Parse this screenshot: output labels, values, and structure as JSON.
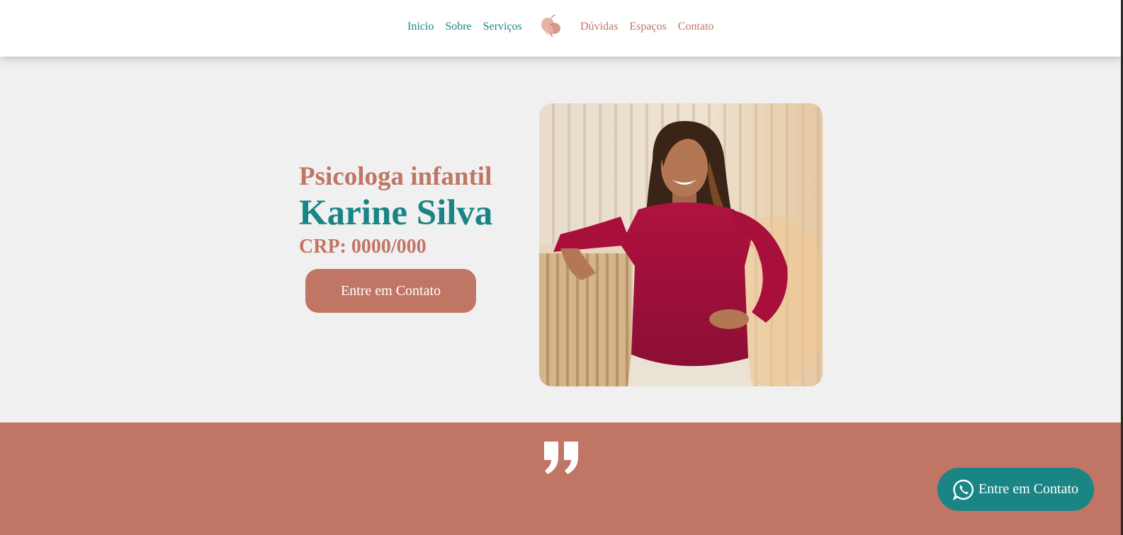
{
  "header": {
    "nav_left": [
      "Inicio",
      "Sobre",
      "Serviços"
    ],
    "nav_right": [
      "Dúvidas",
      "Espaços",
      "Contato"
    ],
    "logo_icon": "butterfly-logo-icon"
  },
  "hero": {
    "subtitle": "Psicologa infantil",
    "name": "Karine Silva",
    "crp": "CRP: 0000/000",
    "cta_label": "Entre em Contato",
    "photo_icon": "portrait-photo"
  },
  "quote": {
    "icon": "quote-icon"
  },
  "floating": {
    "label": "Entre em Contato",
    "icon": "whatsapp-icon"
  },
  "colors": {
    "teal": "#1a8585",
    "terracotta": "#c17565",
    "background": "#f0f0f0",
    "header": "#ffffff"
  }
}
